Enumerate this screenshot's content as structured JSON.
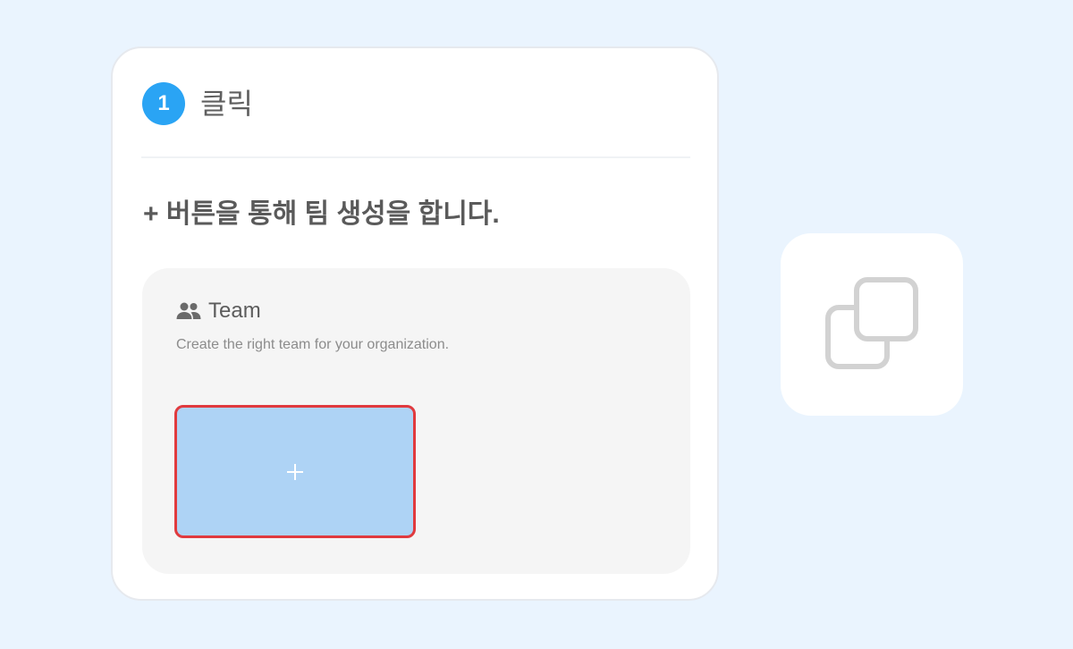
{
  "step": {
    "number": "1",
    "title": "클릭"
  },
  "instruction": "+ 버튼을 통해 팀 생성을 합니다.",
  "team_panel": {
    "icon": "people-icon",
    "title": "Team",
    "description": "Create the right team for your organization.",
    "add_button_icon": "plus-icon"
  },
  "side_tile": {
    "icon": "copy-icon"
  },
  "colors": {
    "background": "#eaf4fe",
    "step_badge": "#2aa4f4",
    "add_button_fill": "#aed3f5",
    "highlight_border": "#e03a3e",
    "icon_gray": "#d2d2d2"
  }
}
